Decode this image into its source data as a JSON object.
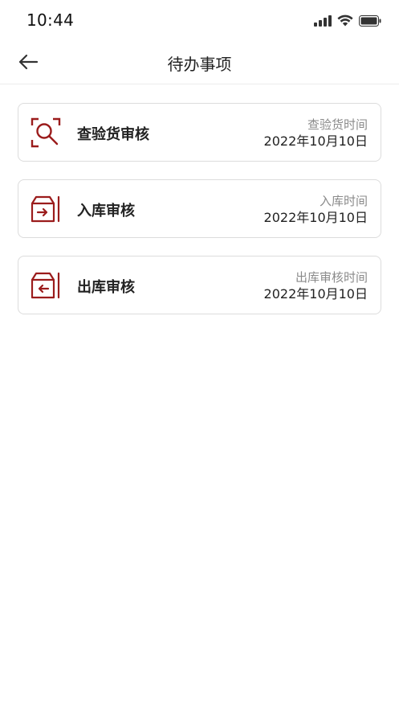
{
  "status_bar": {
    "time": "10:44",
    "icons": [
      "signal-icon",
      "wifi-icon",
      "battery-icon"
    ]
  },
  "nav": {
    "back_icon": "arrow-left-icon",
    "title": "待办事项"
  },
  "accent_color": "#9b1c1c",
  "items": [
    {
      "icon": "inspect-search-icon",
      "title": "查验货审核",
      "label": "查验货时间",
      "date": "2022年10月10日"
    },
    {
      "icon": "box-arrow-in-icon",
      "title": "入库审核",
      "label": "入库时间",
      "date": "2022年10月10日"
    },
    {
      "icon": "box-arrow-out-icon",
      "title": "出库审核",
      "label": "出库审核时间",
      "date": "2022年10月10日"
    }
  ]
}
